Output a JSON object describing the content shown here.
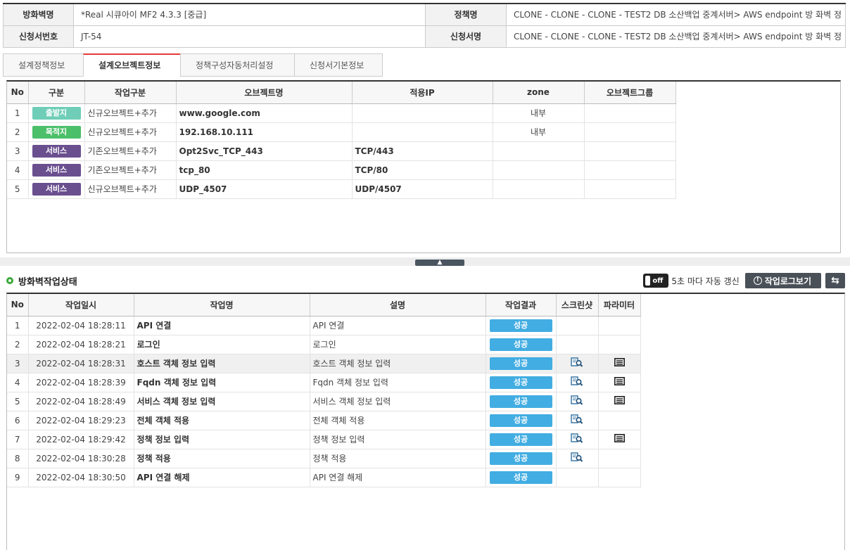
{
  "info": {
    "firewall_label": "방화벽명",
    "firewall_value": "*Real 시큐아이 MF2 4.3.3 [중급]",
    "policy_label": "정책명",
    "policy_value": "CLONE - CLONE - CLONE - TEST2 DB 소산백업 중계서버> AWS endpoint 방 화벽 정",
    "request_no_label": "신청서번호",
    "request_no_value": "JT-54",
    "request_name_label": "신청서명",
    "request_name_value": "CLONE - CLONE - CLONE - TEST2 DB 소산백업 중계서버> AWS endpoint 방 화벽 정"
  },
  "tabs": [
    {
      "label": "설계정책정보"
    },
    {
      "label": "설계오브젝트정보"
    },
    {
      "label": "정책구성자동처리설정"
    },
    {
      "label": "신청서기본정보"
    }
  ],
  "objects": {
    "headers": [
      "No",
      "구분",
      "작업구분",
      "오브젝트명",
      "적용IP",
      "zone",
      "오브젝트그룹"
    ],
    "rows": [
      {
        "no": "1",
        "type": "출발지",
        "color": "#6fcdb8",
        "work": "신규오브젝트+추가",
        "name": "www.google.com",
        "ip": "",
        "zone": "내부",
        "group": ""
      },
      {
        "no": "2",
        "type": "목적지",
        "color": "#4cbf6a",
        "work": "신규오브젝트+추가",
        "name": "192.168.10.111",
        "ip": "",
        "zone": "내부",
        "group": ""
      },
      {
        "no": "3",
        "type": "서비스",
        "color": "#6a4f8f",
        "work": "기존오브젝트+추가",
        "name": "Opt2Svc_TCP_443",
        "ip": "TCP/443",
        "zone": "",
        "group": ""
      },
      {
        "no": "4",
        "type": "서비스",
        "color": "#6a4f8f",
        "work": "기존오브젝트+추가",
        "name": "tcp_80",
        "ip": "TCP/80",
        "zone": "",
        "group": ""
      },
      {
        "no": "5",
        "type": "서비스",
        "color": "#6a4f8f",
        "work": "신규오브젝트+추가",
        "name": "UDP_4507",
        "ip": "UDP/4507",
        "zone": "",
        "group": ""
      }
    ]
  },
  "status": {
    "title": "방화벽작업상태",
    "toggle_label": "off",
    "refresh_text": "5초 마다 자동 갱신",
    "log_button": "작업로그보기",
    "headers": [
      "No",
      "작업일시",
      "작업명",
      "설명",
      "작업결과",
      "스크린샷",
      "파라미터"
    ],
    "rows": [
      {
        "no": "1",
        "time": "2022-02-04 18:28:11",
        "name": "API 연결",
        "desc": "API 연결",
        "result": "성공",
        "shot": false,
        "param": false
      },
      {
        "no": "2",
        "time": "2022-02-04 18:28:21",
        "name": "로그인",
        "desc": "로그인",
        "result": "성공",
        "shot": false,
        "param": false
      },
      {
        "no": "3",
        "time": "2022-02-04 18:28:31",
        "name": "호스트 객체 정보 입력",
        "desc": "호스트 객체 정보 입력",
        "result": "성공",
        "shot": true,
        "param": true
      },
      {
        "no": "4",
        "time": "2022-02-04 18:28:39",
        "name": "Fqdn 객체 정보 입력",
        "desc": "Fqdn 객체 정보 입력",
        "result": "성공",
        "shot": true,
        "param": true
      },
      {
        "no": "5",
        "time": "2022-02-04 18:28:49",
        "name": "서비스 객체 정보 입력",
        "desc": "서비스 객체 정보 입력",
        "result": "성공",
        "shot": true,
        "param": true
      },
      {
        "no": "6",
        "time": "2022-02-04 18:29:23",
        "name": "전체 객체 적용",
        "desc": "전체 객체 적용",
        "result": "성공",
        "shot": true,
        "param": false
      },
      {
        "no": "7",
        "time": "2022-02-04 18:29:42",
        "name": "정책 정보 입력",
        "desc": "정책 정보 입력",
        "result": "성공",
        "shot": true,
        "param": true
      },
      {
        "no": "8",
        "time": "2022-02-04 18:30:28",
        "name": "정책 적용",
        "desc": "정책 적용",
        "result": "성공",
        "shot": true,
        "param": false
      },
      {
        "no": "9",
        "time": "2022-02-04 18:30:50",
        "name": "API 연결 해제",
        "desc": "API 연결 해제",
        "result": "성공",
        "shot": false,
        "param": false
      }
    ]
  }
}
